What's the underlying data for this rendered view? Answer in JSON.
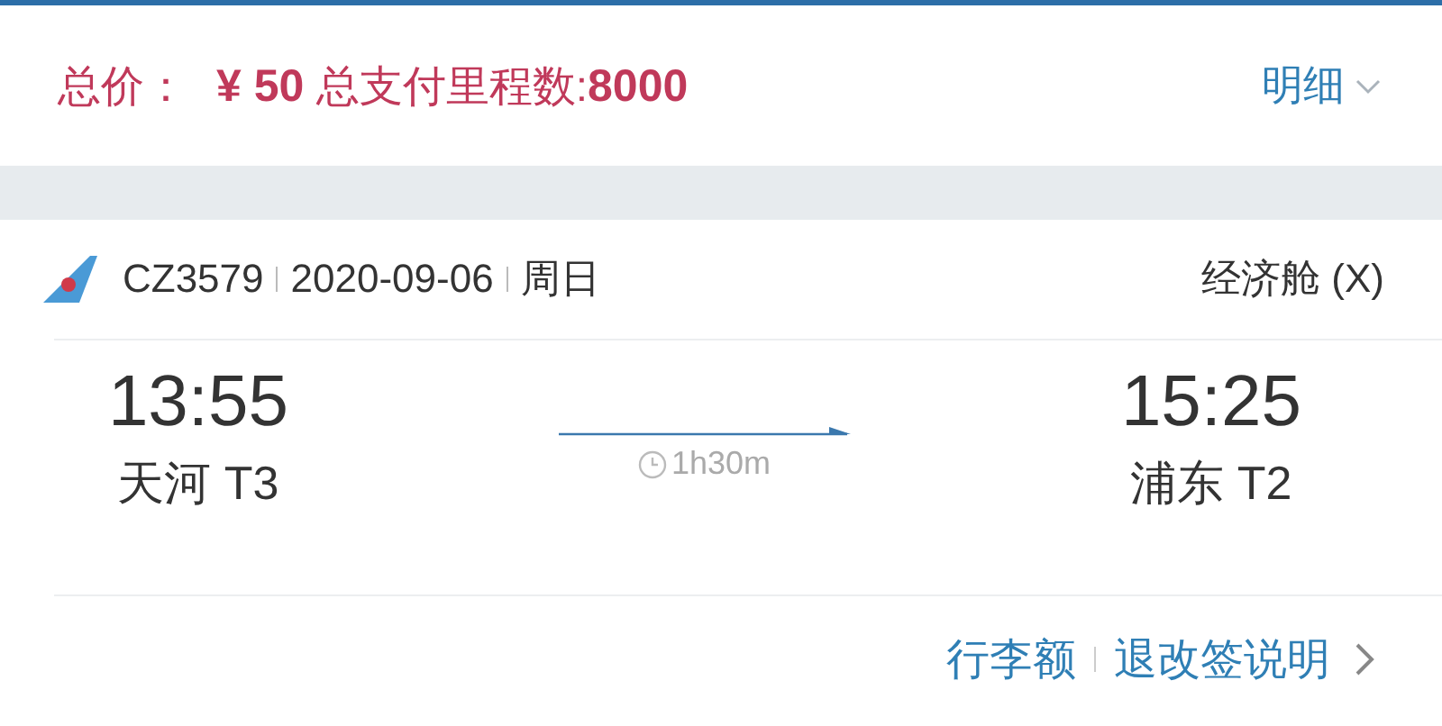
{
  "price_bar": {
    "label": "总价：",
    "amount": "**¥ 50** 总支付里程数:**8000**",
    "details_link": "明细",
    "expanded": false
  },
  "flight": {
    "number": "CZ3579",
    "date": "2020-09-06",
    "weekday": "周日",
    "cabin": "经济舱 (X)",
    "departure": {
      "time": "13:55",
      "airport": "天河 T3"
    },
    "duration": "1h30m",
    "arrival": {
      "time": "15:25",
      "airport": "浦东 T2"
    },
    "links": [
      "行李额",
      "退改签说明"
    ]
  }
}
